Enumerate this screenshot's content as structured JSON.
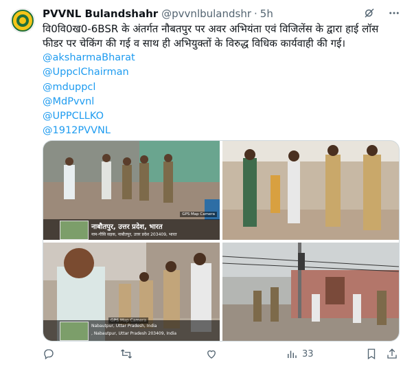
{
  "account": {
    "name": "PVVNL Bulandshahr",
    "handle": "@pvvnlbulandshr",
    "time": "5h"
  },
  "tweet_text": "वि0वि0ख0-6BSR के अंतर्गत नौबतपुर पर अवर अभियंता एवं विजिलेंस के द्वारा हाई लॉस फीडर पर चेकिंग की गई व साथ ही अभियुक्तों के विरुद्ध विधिक कार्यवाही की गई।",
  "mentions": [
    "@aksharmaBharat",
    "@UppclChairman",
    "@mduppcl",
    "@MdPvvnl",
    "@UPPCLLKO",
    "@1912PVVNL"
  ],
  "media": {
    "photo1": {
      "place": "नाबौतपुर, उत्तर प्रदेश, भारत",
      "address": "नाम-गौसि सड़क, नाबौतपुर, उत्तर प्रदेश 203409, भारत",
      "app": "GPS Map Camera"
    },
    "photo3": {
      "place_line1": "Nabautpur, Uttar Pradesh, India",
      "address": ", Nabautpur, Uttar Pradesh 203409, India",
      "app": "GPS Map Camera"
    }
  },
  "actions": {
    "views": "33"
  },
  "colors": {
    "link": "#1d9bf0",
    "muted": "#536471",
    "text": "#0f1419"
  }
}
